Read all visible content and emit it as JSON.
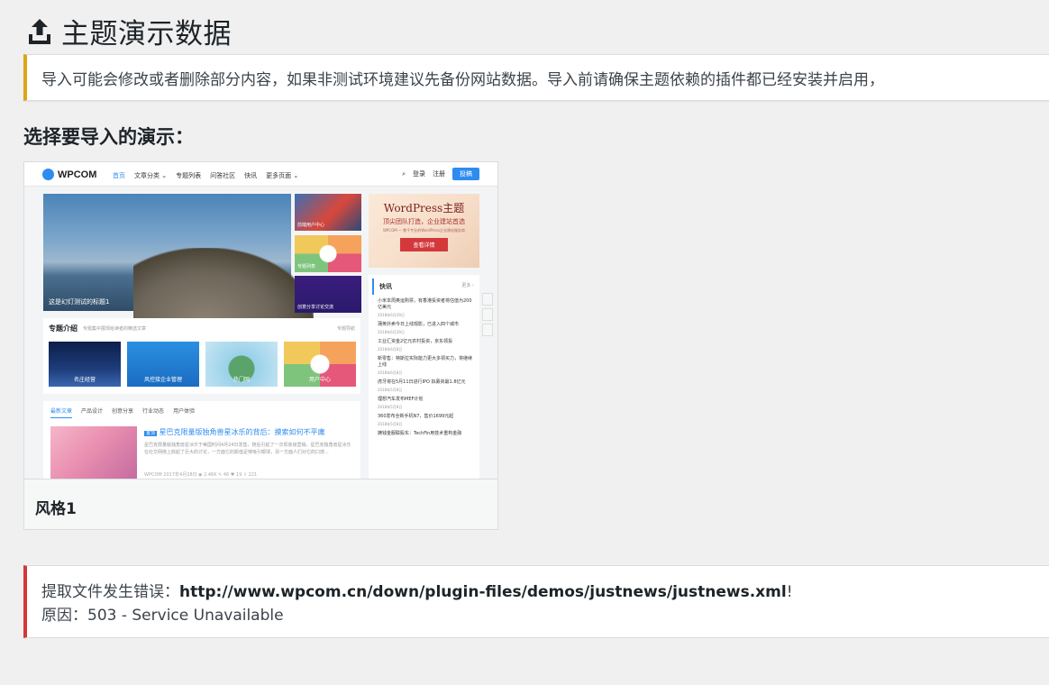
{
  "header": {
    "title": "主题演示数据",
    "icon": "upload-icon"
  },
  "notice_warning": {
    "text": "导入可能会修改或者删除部分内容，如果非测试环境建议先备份网站数据。导入前请确保主题依赖的插件都已经安装并启用，",
    "color": "#dba617"
  },
  "section": {
    "heading": "选择要导入的演示："
  },
  "demo": {
    "caption": "风格1",
    "preview": {
      "logo": "WPCOM",
      "menu": [
        "首页",
        "文章分类 ⌄",
        "专题列表",
        "问答社区",
        "快讯",
        "更多页面 ⌄"
      ],
      "login": "登录",
      "register": "注册",
      "post_button": "投稿",
      "hero_caption": "这是幻灯测试的标题1",
      "thumbs": [
        "前端用户中心",
        "专题列表",
        "创意分享讨论交流"
      ],
      "ad": {
        "title": "WordPress主题",
        "subtitle": "顶尖团队打造，企业建站首选",
        "line": "WPCOM — 数千专业的WordPress企业建站服务商",
        "button": "查看详情"
      },
      "news_heading": "快讯",
      "news_more": "更多 ›",
      "news": [
        {
          "t": "小米本周奥运购票，有香港投资者将估值为200亿美元",
          "d": "2018年6月29日"
        },
        {
          "t": "蒲英外卖今日上线观影，已进入四个城市",
          "d": "2018年6月29日"
        },
        {
          "t": "工业汇资金2亿元农村投资，京东领投",
          "d": "2018年6月8日"
        },
        {
          "t": "新零售：特斯拉实际能力更大多领买力，将继续上线",
          "d": "2018年6月8日"
        },
        {
          "t": "虎牙将在5月11日进行IPO 拟募资最1.8亿元",
          "d": "2018年5月8日"
        },
        {
          "t": "理想汽车发布MEF计划",
          "d": "2018年5月8日"
        },
        {
          "t": "360发布全新手机N7，售价1699元起",
          "d": "2018年5月8日"
        },
        {
          "t": "摘钱金服联股东：TechFin用技术重构金融",
          "d": ""
        }
      ],
      "topics_heading": "专题介绍",
      "topics_sub": "专题集中展现给读者的精选文章",
      "topics_more": "专题导航",
      "topics": [
        "名庄经营",
        "风控接企业管理",
        "热门网",
        "用户中心"
      ],
      "tabs": [
        "最新文章",
        "产品设计",
        "创意分享",
        "行业动态",
        "用户体验"
      ],
      "article_title": "星巴克限量版独角兽星冰乐的背后：摸索如何不平庸",
      "article_tag": "置顶",
      "article_excerpt": "星巴克限量版独角兽星冰乐于美国时间4月24日发售，随后引起了一次现象级营销。星巴克独角兽星冰乐在社交网络上掀起了巨大的讨论，一方面它的颜值足够吸引眼球，另一方面人们对它的口感...",
      "article_meta": "WPCOM   2017年4月28日   ◉ 2.46K   ✎ 46   ♥ 19   ⇪ 221"
    }
  },
  "notice_error": {
    "prefix": "提取文件发生错误：",
    "url": "http://www.wpcom.cn/down/plugin-files/demos/justnews/justnews.xml",
    "suffix": "!",
    "reason": "原因：503 - Service Unavailable",
    "color": "#d63638"
  }
}
